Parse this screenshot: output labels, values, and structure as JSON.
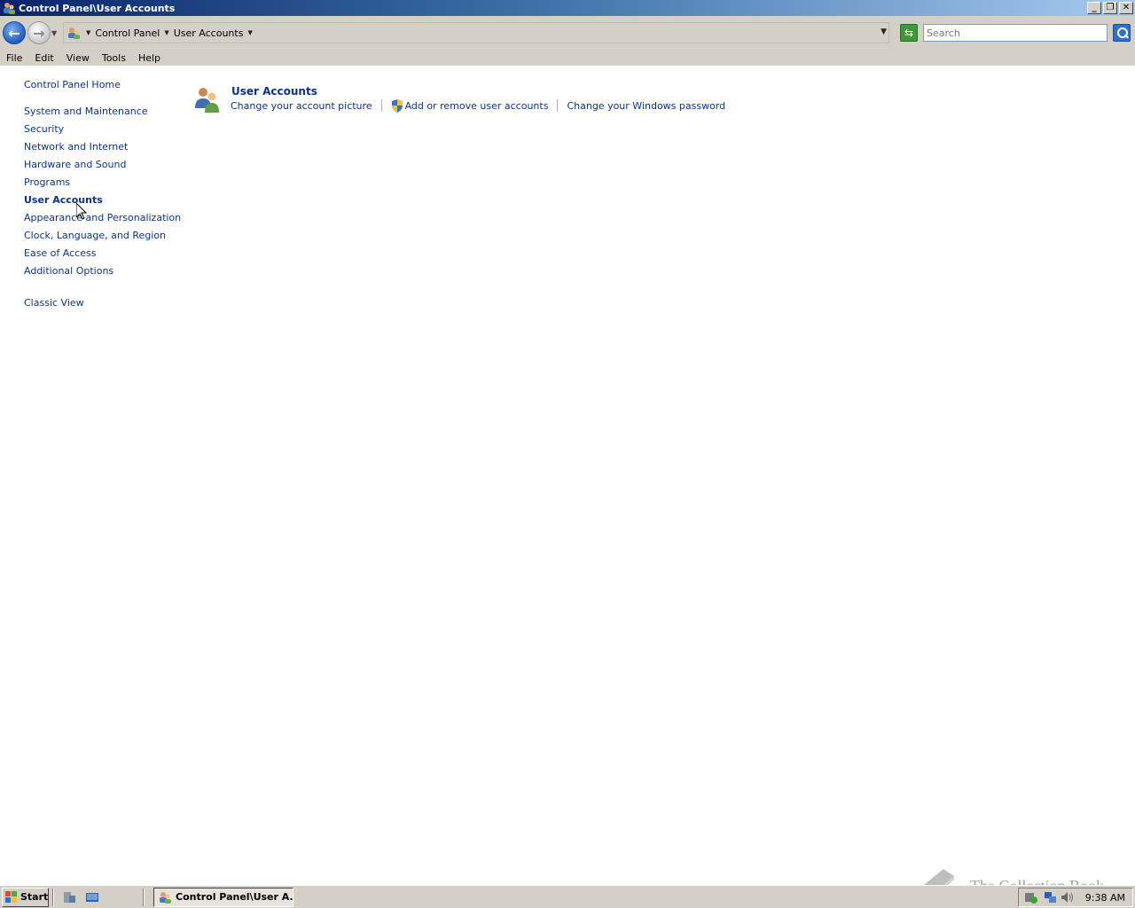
{
  "window": {
    "title": "Control Panel\\User Accounts",
    "controls": {
      "minimize": "_",
      "restore": "❐",
      "close": "✕"
    }
  },
  "address_bar": {
    "crumbs": [
      "Control Panel",
      "User Accounts"
    ],
    "search_placeholder": "Search"
  },
  "menu": [
    "File",
    "Edit",
    "View",
    "Tools",
    "Help"
  ],
  "sidebar": {
    "home": "Control Panel Home",
    "items": [
      "System and Maintenance",
      "Security",
      "Network and Internet",
      "Hardware and Sound",
      "Programs",
      "User Accounts",
      "Appearance and Personalization",
      "Clock, Language, and Region",
      "Ease of Access",
      "Additional Options"
    ],
    "active_item": "User Accounts",
    "classic_view": "Classic View"
  },
  "main": {
    "section_title": "User Accounts",
    "tasks": [
      "Change your account picture",
      "Add or remove user accounts",
      "Change your Windows password"
    ]
  },
  "watermark": {
    "text": "The Collection Book"
  },
  "taskbar": {
    "start_label": "Start",
    "task_button": "Control Panel\\User A...",
    "clock": "9:38 AM"
  },
  "colors": {
    "link": "#0b3289",
    "chrome": "#d4d0c8",
    "title_gradient_start": "#0a246a",
    "title_gradient_end": "#a6caf0"
  }
}
